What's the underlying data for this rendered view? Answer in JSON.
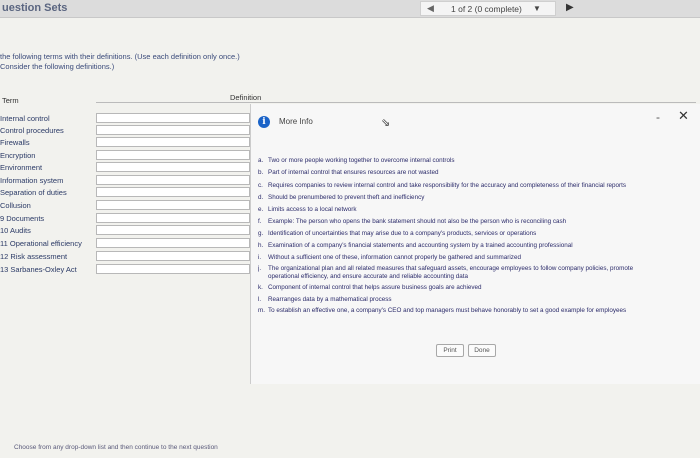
{
  "topbar": {
    "title": "uestion Sets",
    "pager_text": "1 of 2 (0 complete)",
    "prev_icon": "◀",
    "dropdown_icon": "▼",
    "next_icon": "▶"
  },
  "instructions": {
    "line1": "the following terms with their definitions. (Use each definition only once.)",
    "line2": "Consider the following definitions.)"
  },
  "headers": {
    "term": "Term",
    "definition": "Definition"
  },
  "terms": [
    "Internal control",
    "Control procedures",
    "Firewalls",
    "Encryption",
    "Environment",
    "Information system",
    "Separation of duties",
    "Collusion",
    "9  Documents",
    "10  Audits",
    "11  Operational efficiency",
    "12  Risk assessment",
    "13  Sarbanes-Oxley Act"
  ],
  "more_info": {
    "title": "More Info",
    "icon": "info-icon",
    "minimize": "-",
    "close": "✕"
  },
  "definitions": [
    {
      "letter": "a.",
      "text": "Two or more people working together to overcome internal controls"
    },
    {
      "letter": "b.",
      "text": "Part of internal control that ensures resources are not wasted"
    },
    {
      "letter": "c.",
      "text": "Requires companies to review internal control and take responsibility for the accuracy and completeness of their financial reports"
    },
    {
      "letter": "d.",
      "text": "Should be prenumbered to prevent theft and inefficiency"
    },
    {
      "letter": "e.",
      "text": "Limits access to a local network"
    },
    {
      "letter": "f.",
      "text": "Example: The person who opens the bank statement should not also be the person who is reconciling cash"
    },
    {
      "letter": "g.",
      "text": "Identification of uncertainties that may arise due to a company's products, services or operations"
    },
    {
      "letter": "h.",
      "text": "Examination of a company's financial statements and accounting system by a trained accounting professional"
    },
    {
      "letter": "i.",
      "text": "Without a sufficient one of these, information cannot properly be gathered and summarized"
    },
    {
      "letter": "j.",
      "text": "The organizational plan and all related measures that safeguard assets, encourage employees to follow company policies, promote"
    },
    {
      "letter": "",
      "text": "operational efficiency, and ensure accurate and reliable accounting data"
    },
    {
      "letter": "k.",
      "text": "Component of internal control that helps assure business goals are achieved"
    },
    {
      "letter": "l.",
      "text": "Rearranges data by a mathematical process"
    },
    {
      "letter": "m.",
      "text": "To establish an effective one, a company's CEO and top managers must behave honorably to set a good example for employees"
    }
  ],
  "buttons": {
    "print": "Print",
    "done": "Done"
  },
  "footer": {
    "hint": "Choose from any drop-down list and then continue to the next question"
  }
}
